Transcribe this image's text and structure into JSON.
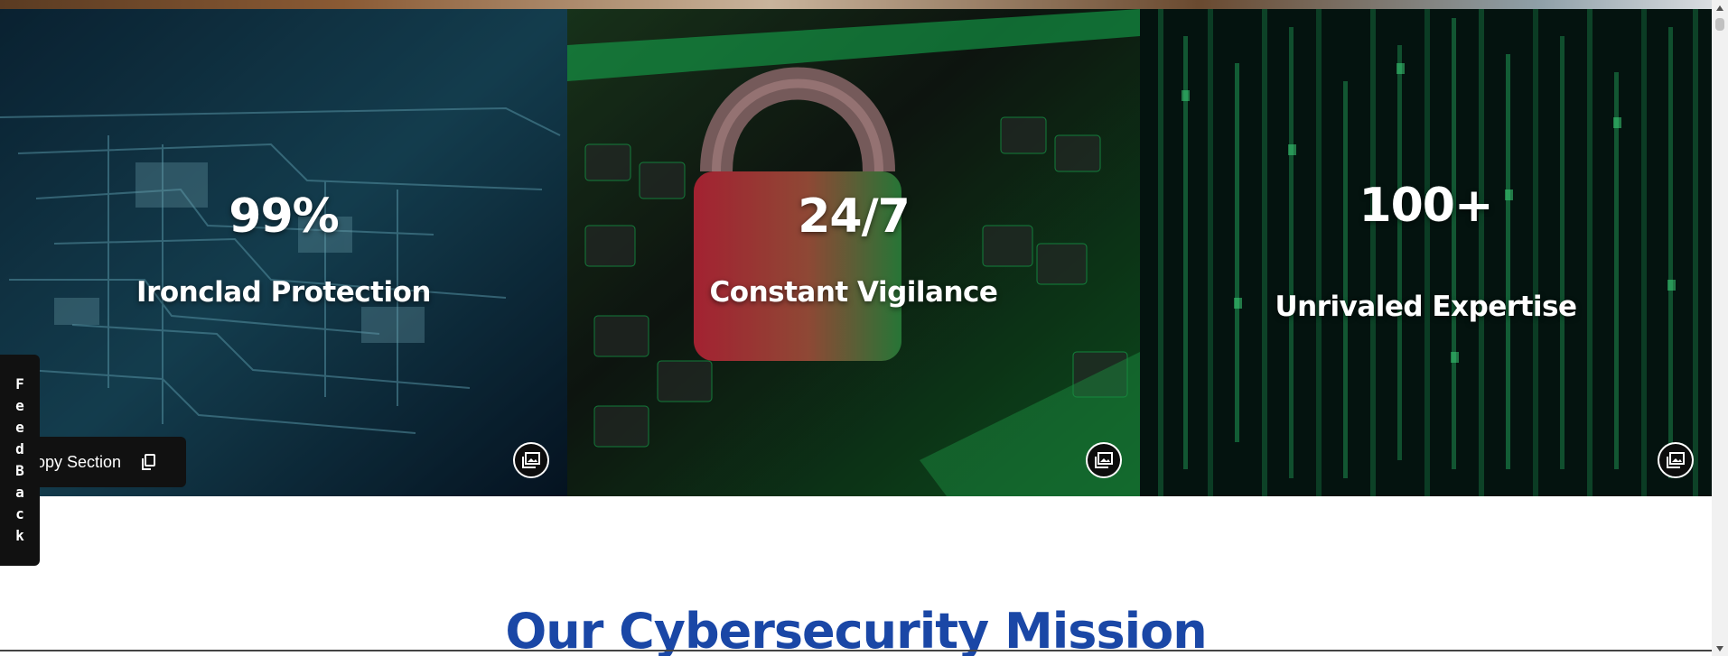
{
  "stats": [
    {
      "value": "99%",
      "label": "Ironclad Protection"
    },
    {
      "value": "24/7",
      "label": "Constant Vigilance"
    },
    {
      "value": "100+",
      "label": "Unrivaled Expertise"
    }
  ],
  "toolbar": {
    "copy_section_label": "opy Section",
    "feedback_label": "FeedBack"
  },
  "mission": {
    "title": "Our Cybersecurity Mission"
  },
  "icons": {
    "image_badge": "image-icon",
    "copy": "copy-icon"
  },
  "colors": {
    "heading_blue": "#1a47a6",
    "card_overlay": "#0b1a2a",
    "accent_green": "#19c25a",
    "lock_red": "#c0283a"
  }
}
